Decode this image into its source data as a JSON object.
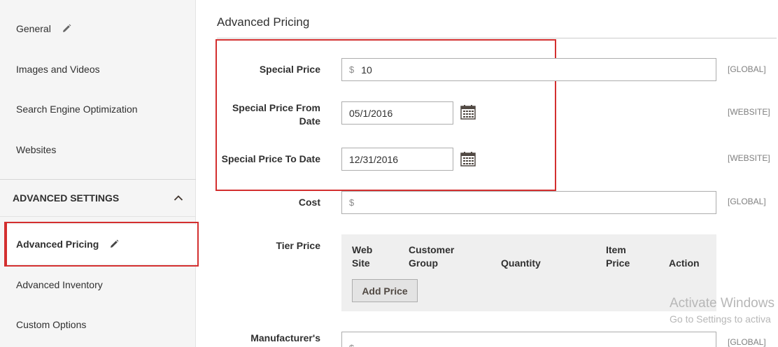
{
  "sidebar": {
    "items": [
      {
        "label": "General",
        "edited": true
      },
      {
        "label": "Images and Videos"
      },
      {
        "label": "Search Engine Optimization"
      },
      {
        "label": "Websites"
      }
    ],
    "section_title": "ADVANCED SETTINGS",
    "section_items": [
      {
        "label": "Advanced Pricing",
        "active": true,
        "edited": true
      },
      {
        "label": "Advanced Inventory"
      },
      {
        "label": "Custom Options"
      }
    ]
  },
  "main": {
    "title": "Advanced Pricing",
    "fields": {
      "special_price": {
        "label": "Special Price",
        "currency": "$",
        "value": "10",
        "scope": "[GLOBAL]"
      },
      "from_date": {
        "label_line1": "Special Price From",
        "label_line2": "Date",
        "value": "05/1/2016",
        "scope": "[WEBSITE]"
      },
      "to_date": {
        "label": "Special Price To Date",
        "value": "12/31/2016",
        "scope": "[WEBSITE]"
      },
      "cost": {
        "label": "Cost",
        "currency": "$",
        "value": "",
        "scope": "[GLOBAL]"
      },
      "tier_price": {
        "label": "Tier Price",
        "columns": {
          "website_line1": "Web",
          "website_line2": "Site",
          "group_line1": "Customer",
          "group_line2": "Group",
          "quantity": "Quantity",
          "price_line1": "Item",
          "price_line2": "Price",
          "action": "Action"
        },
        "add_button": "Add Price"
      },
      "msrp": {
        "label": "Manufacturer's",
        "currency": "$",
        "scope": "[GLOBAL]"
      }
    }
  },
  "watermark": {
    "line1": "Activate Windows",
    "line2": "Go to Settings to activa"
  },
  "colors": {
    "highlight": "#d32f2f",
    "sidebar_bg": "#f5f5f5",
    "tier_bg": "#efefef"
  }
}
